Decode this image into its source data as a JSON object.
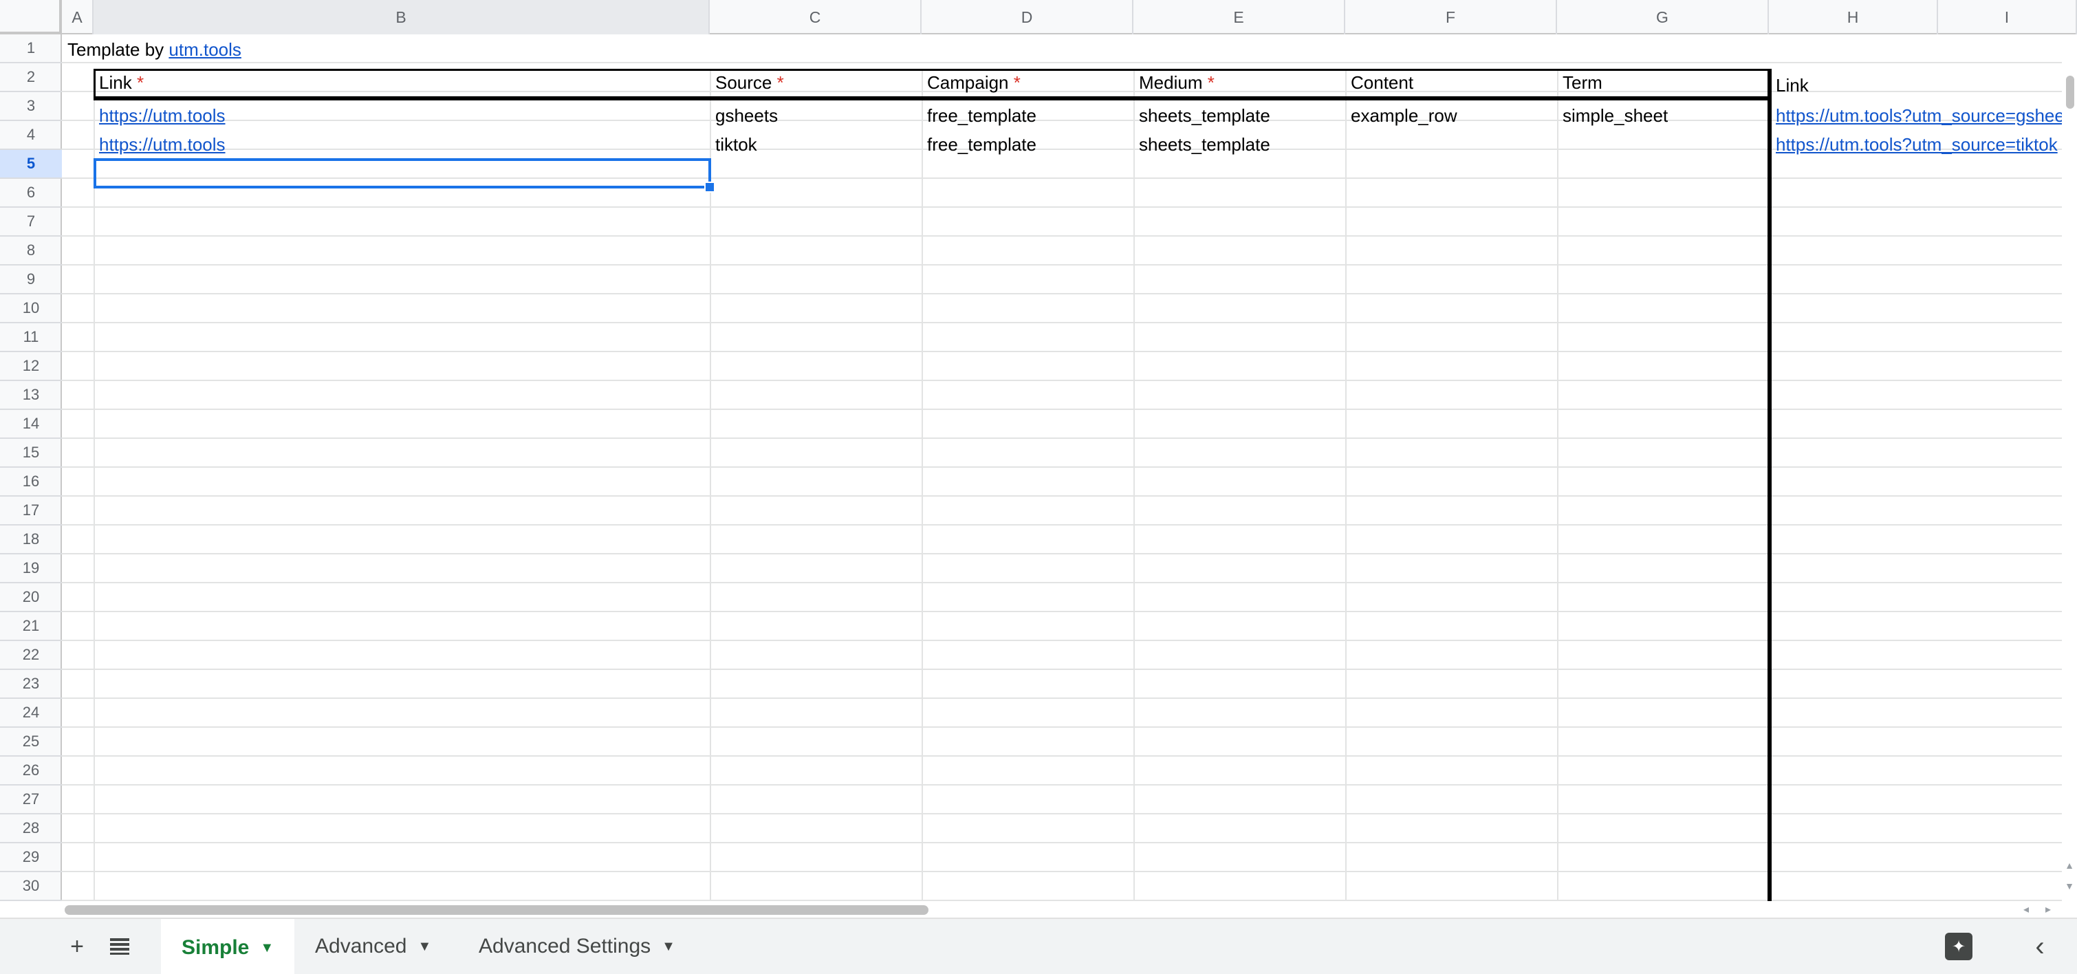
{
  "columns": [
    "A",
    "B",
    "C",
    "D",
    "E",
    "F",
    "G",
    "H",
    "I"
  ],
  "rows": [
    "1",
    "2",
    "3",
    "4",
    "5",
    "6",
    "7",
    "8",
    "9",
    "10",
    "11",
    "12",
    "13",
    "14",
    "15",
    "16",
    "17",
    "18",
    "19",
    "20",
    "21",
    "22",
    "23",
    "24",
    "25",
    "26",
    "27",
    "28",
    "29",
    "30"
  ],
  "title_cell": {
    "prefix": "Template by ",
    "link": "utm.tools"
  },
  "headers": {
    "link": "Link",
    "source": "Source",
    "campaign": "Campaign",
    "medium": "Medium",
    "content": "Content",
    "term": "Term",
    "required_mark": "*",
    "output_link": "Link"
  },
  "data_rows": [
    {
      "link": "https://utm.tools",
      "source": "gsheets",
      "campaign": "free_template",
      "medium": "sheets_template",
      "content": "example_row",
      "term": "simple_sheet",
      "output": "https://utm.tools?utm_source=gsheets"
    },
    {
      "link": "https://utm.tools",
      "source": "tiktok",
      "campaign": "free_template",
      "medium": "sheets_template",
      "content": "",
      "term": "",
      "output": "https://utm.tools?utm_source=tiktok"
    }
  ],
  "selected_cell": "B5",
  "tabs": [
    {
      "label": "Simple",
      "active": true
    },
    {
      "label": "Advanced",
      "active": false
    },
    {
      "label": "Advanced Settings",
      "active": false
    }
  ],
  "icons": {
    "add_sheet": "plus-icon",
    "all_sheets": "list-icon",
    "tab_menu": "caret-down-icon",
    "explore": "explore-icon",
    "side_panel": "chevron-left-icon"
  },
  "colors": {
    "link": "#1155cc",
    "required": "#d93025",
    "active_tab": "#188038",
    "selection": "#1a73e8"
  }
}
